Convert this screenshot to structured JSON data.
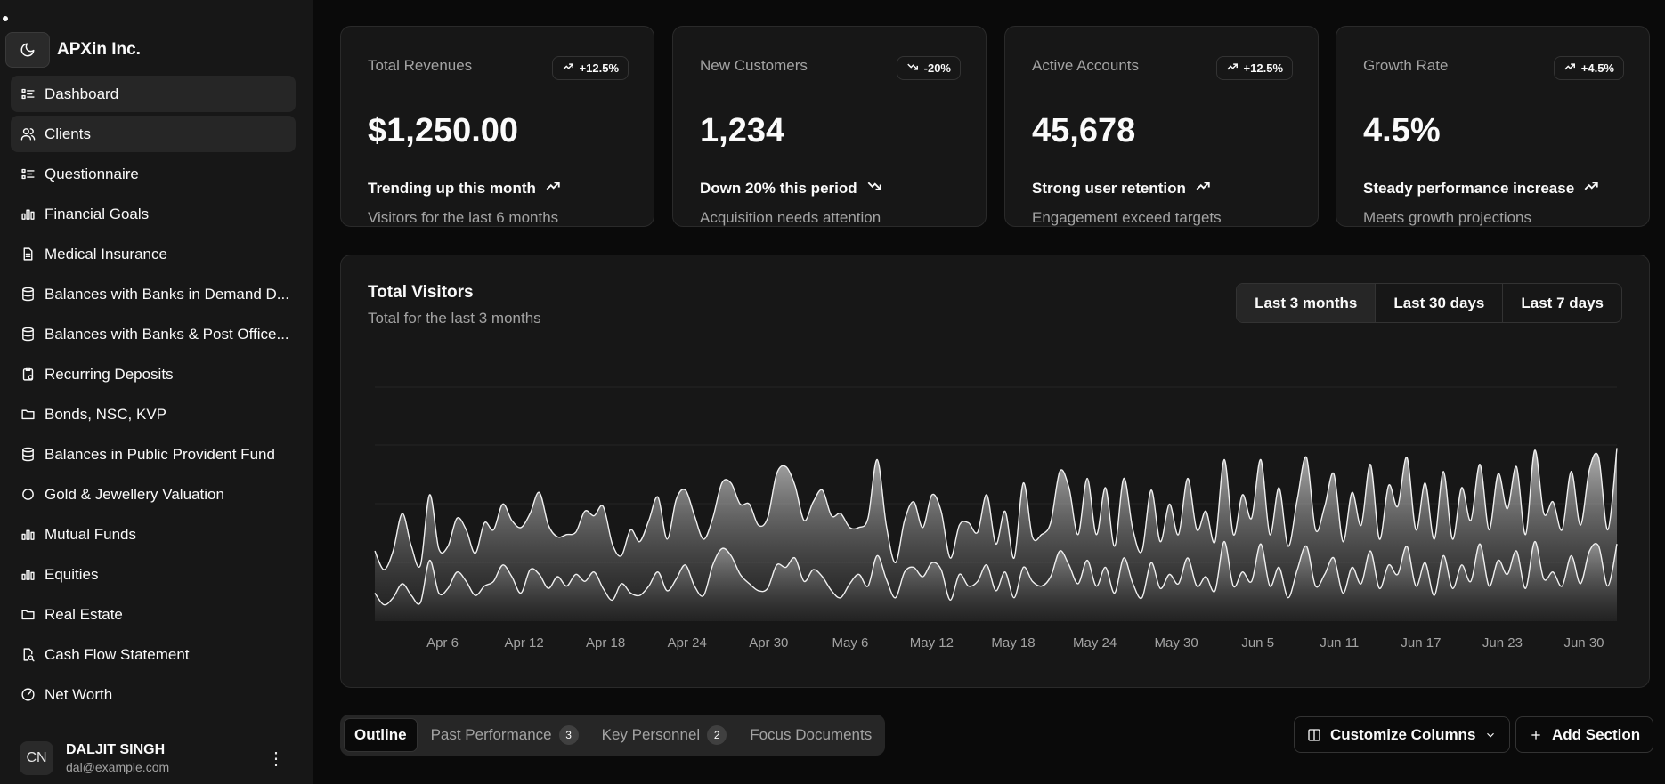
{
  "app": {
    "brand": "APXin Inc."
  },
  "sidebar": {
    "items": [
      {
        "label": "Dashboard",
        "icon": "list-icon",
        "active": true
      },
      {
        "label": "Clients",
        "icon": "users-icon",
        "active": true
      },
      {
        "label": "Questionnaire",
        "icon": "list-icon"
      },
      {
        "label": "Financial Goals",
        "icon": "bar-chart-icon"
      },
      {
        "label": "Medical Insurance",
        "icon": "file-icon"
      },
      {
        "label": "Balances with Banks in Demand D...",
        "icon": "database-icon"
      },
      {
        "label": "Balances with Banks & Post Office...",
        "icon": "database-icon"
      },
      {
        "label": "Recurring Deposits",
        "icon": "clipboard-icon"
      },
      {
        "label": "Bonds, NSC, KVP",
        "icon": "folder-icon"
      },
      {
        "label": "Balances in Public Provident Fund",
        "icon": "database-icon"
      },
      {
        "label": "Gold & Jewellery Valuation",
        "icon": "circle-icon"
      },
      {
        "label": "Mutual Funds",
        "icon": "bar-chart-icon"
      },
      {
        "label": "Equities",
        "icon": "bar-chart-icon"
      },
      {
        "label": "Real Estate",
        "icon": "folder-icon"
      },
      {
        "label": "Cash Flow Statement",
        "icon": "file-search-icon"
      },
      {
        "label": "Net Worth",
        "icon": "gauge-icon"
      }
    ]
  },
  "user": {
    "initials": "CN",
    "name": "DALJIT SINGH",
    "email": "dal@example.com"
  },
  "cards": [
    {
      "title": "Total Revenues",
      "badge": "+12.5%",
      "trend": "up",
      "value": "$1,250.00",
      "foot": "Trending up this month",
      "sub": "Visitors for the last 6 months"
    },
    {
      "title": "New Customers",
      "badge": "-20%",
      "trend": "down",
      "value": "1,234",
      "foot": "Down 20% this period",
      "sub": "Acquisition needs attention"
    },
    {
      "title": "Active Accounts",
      "badge": "+12.5%",
      "trend": "up",
      "value": "45,678",
      "foot": "Strong user retention",
      "sub": "Engagement exceed targets"
    },
    {
      "title": "Growth Rate",
      "badge": "+4.5%",
      "trend": "up",
      "value": "4.5%",
      "foot": "Steady performance increase",
      "sub": "Meets growth projections"
    }
  ],
  "visitors": {
    "title": "Total Visitors",
    "subtitle": "Total for the last 3 months",
    "ranges": [
      "Last 3 months",
      "Last 30 days",
      "Last 7 days"
    ],
    "selected_range": "Last 3 months"
  },
  "chart_data": {
    "type": "area",
    "title": "Total Visitors",
    "stacked": true,
    "grid": true,
    "x_tick_labels": [
      "Apr 6",
      "Apr 12",
      "Apr 18",
      "Apr 24",
      "Apr 30",
      "May 6",
      "May 12",
      "May 18",
      "May 24",
      "May 30",
      "Jun 5",
      "Jun 11",
      "Jun 17",
      "Jun 23",
      "Jun 30"
    ],
    "y_range": [
      0,
      1000
    ],
    "series": [
      {
        "values": [
          120,
          70,
          100,
          160,
          110,
          80,
          260,
          120,
          140,
          210,
          170,
          110,
          150,
          170,
          240,
          190,
          120,
          220,
          200,
          140,
          190,
          150,
          200,
          170,
          210,
          140,
          90,
          160,
          120,
          110,
          150,
          210,
          130,
          180,
          240,
          150,
          110,
          240,
          310,
          280,
          200,
          160,
          130,
          140,
          240,
          230,
          270,
          170,
          220,
          190,
          130,
          100,
          160,
          200,
          150,
          280,
          180,
          100,
          210,
          230,
          190,
          250,
          220,
          90,
          200,
          150,
          170,
          240,
          130,
          210,
          100,
          230,
          170,
          150,
          190,
          300,
          240,
          160,
          260,
          150,
          230,
          120,
          270,
          160,
          100,
          250,
          140,
          200,
          160,
          270,
          150,
          190,
          130,
          340,
          150,
          210,
          170,
          330,
          150,
          230,
          100,
          220,
          320,
          150,
          200,
          270,
          120,
          230,
          160,
          300,
          140,
          240,
          200,
          320,
          150,
          250,
          110,
          280,
          140,
          240,
          170,
          330,
          150,
          260,
          200,
          300,
          140,
          340,
          180,
          210,
          150,
          280,
          160,
          300,
          320,
          150,
          330
        ]
      },
      {
        "values": [
          180,
          150,
          200,
          300,
          210,
          160,
          280,
          190,
          180,
          230,
          220,
          180,
          270,
          220,
          260,
          240,
          280,
          240,
          350,
          270,
          170,
          220,
          180,
          300,
          240,
          350,
          240,
          120,
          270,
          230,
          280,
          320,
          220,
          340,
          320,
          300,
          240,
          200,
          280,
          310,
          300,
          340,
          280,
          300,
          390,
          430,
          310,
          260,
          290,
          370,
          320,
          360,
          240,
          200,
          290,
          410,
          230,
          150,
          220,
          280,
          210,
          290,
          250,
          180,
          210,
          270,
          210,
          300,
          200,
          260,
          170,
          360,
          190,
          220,
          230,
          340,
          330,
          210,
          350,
          220,
          340,
          200,
          340,
          230,
          200,
          310,
          200,
          300,
          210,
          340,
          240,
          280,
          210,
          350,
          220,
          330,
          270,
          360,
          220,
          340,
          220,
          300,
          380,
          240,
          290,
          360,
          220,
          320,
          250,
          370,
          210,
          340,
          290,
          380,
          240,
          340,
          240,
          360,
          210,
          330,
          260,
          340,
          240,
          370,
          280,
          360,
          230,
          390,
          280,
          300,
          240,
          360,
          250,
          350,
          380,
          240,
          410
        ]
      }
    ]
  }
}
